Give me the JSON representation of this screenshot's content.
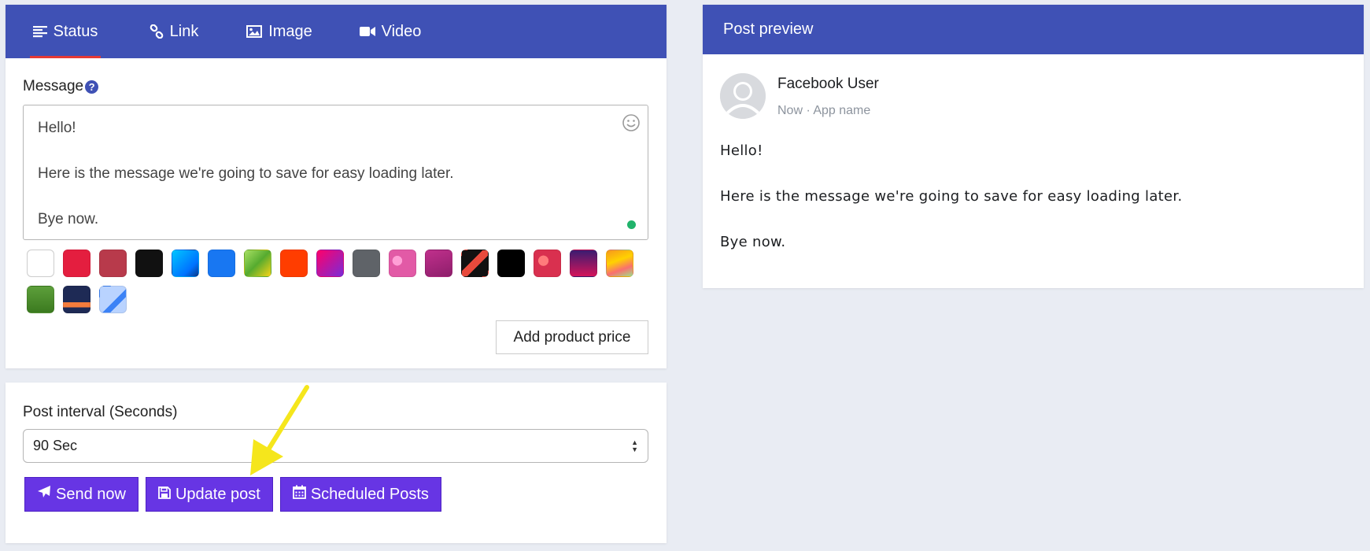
{
  "tabs": [
    {
      "label": "Status",
      "icon": "align-left-icon",
      "active": true
    },
    {
      "label": "Link",
      "icon": "link-icon",
      "active": false
    },
    {
      "label": "Image",
      "icon": "image-icon",
      "active": false
    },
    {
      "label": "Video",
      "icon": "video-camera-icon",
      "active": false
    }
  ],
  "composer": {
    "message_label": "Message",
    "message_lines": [
      "Hello!",
      "",
      "Here is the message we're going to save for easy loading later.",
      "",
      "Bye now."
    ],
    "background_swatches": [
      "#ffffff",
      "#e41e3f",
      "#b83a4b",
      "#111111",
      "linear-gradient(135deg,#00c6ff,#0072ff 70%,#0a3a8a)",
      "#1877f2",
      "linear-gradient(135deg,#a8e063,#56ab2f 50%,#f7d417)",
      "#ff3d00",
      "linear-gradient(135deg,#ff0069,#7a2bd8)",
      "#5f6368",
      "radial-gradient(circle at 30% 40%,#ff9fd6 0 20%,#e25aa6 21%)",
      "linear-gradient(160deg,#c0308c,#8e1e6b)",
      "linear-gradient(135deg,#111 0 40%,#e84a3c 40% 60%,#111 60%)",
      "#000000",
      "radial-gradient(circle at 35% 40%,#ff7b7b 0 22%,#d9304f 23%)",
      "linear-gradient(180deg,#3a1c71,#d4145a)",
      "linear-gradient(160deg,#f7971e,#ffd200 40%,#f96f6f 70%,#a0e089)",
      "linear-gradient(180deg,#5d9f3b,#3b7a1f)",
      "linear-gradient(180deg,#1e2a55 0 60%,#f47c3c 60% 80%,#1e2a55 80%)",
      "linear-gradient(135deg,#b9d3ff 0 55%,#3b82f6 55% 70%,#b9d3ff 70%)"
    ],
    "add_price_label": "Add product price"
  },
  "interval": {
    "label": "Post interval (Seconds)",
    "selected": "90 Sec"
  },
  "buttons": {
    "send_now": "Send now",
    "update_post": "Update post",
    "scheduled_posts": "Scheduled Posts"
  },
  "preview": {
    "header": "Post preview",
    "user_name": "Facebook User",
    "meta": "Now · App name",
    "lines": [
      "Hello!",
      "",
      "Here is the message we're going to save for easy loading later.",
      "",
      "Bye now."
    ]
  },
  "colors": {
    "primary": "#3f51b5",
    "button": "#6735e4",
    "active_tab_indicator": "#e53935",
    "annotation_arrow": "#f5e61c"
  }
}
